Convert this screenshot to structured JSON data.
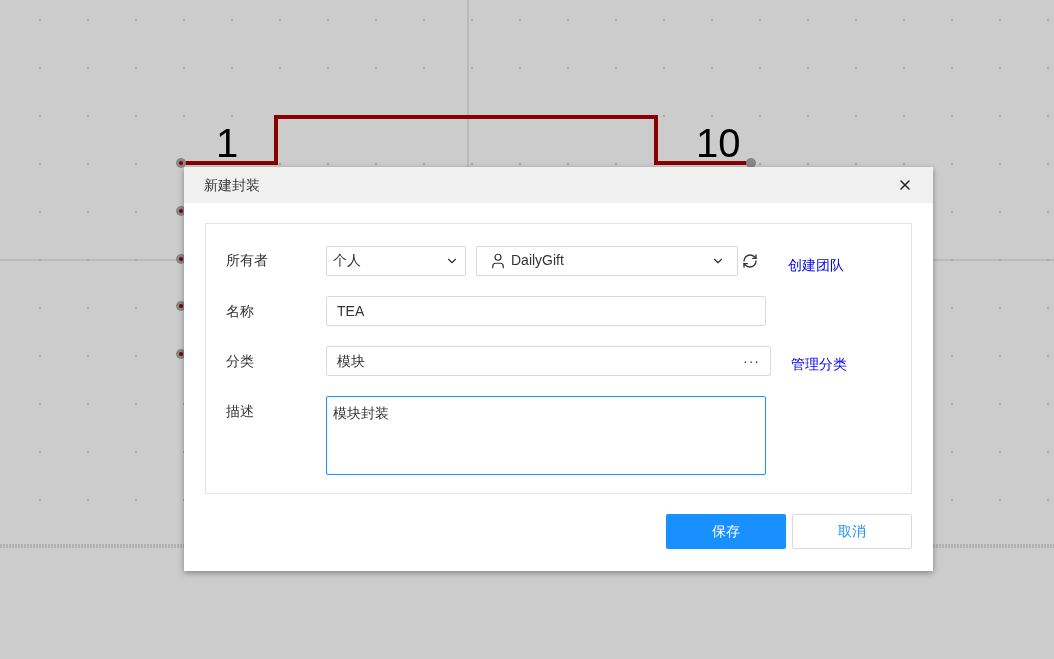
{
  "schematic": {
    "left_pin_number": "1",
    "right_pin_number": "10"
  },
  "dialog": {
    "title": "新建封装",
    "fields": [
      {
        "kind": "owner",
        "label": "所有者",
        "owner_type": "个人",
        "account": "DailyGift",
        "link": "创建团队"
      },
      {
        "kind": "text",
        "label": "名称",
        "value": "TEA"
      },
      {
        "kind": "picker",
        "label": "分类",
        "value": "模块",
        "more": "···",
        "link": "管理分类"
      },
      {
        "kind": "textarea",
        "label": "描述",
        "value": "模块封装",
        "focused": true
      }
    ],
    "buttons": [
      {
        "label": "保存",
        "primary": true
      },
      {
        "label": "取消",
        "primary": false
      }
    ]
  }
}
